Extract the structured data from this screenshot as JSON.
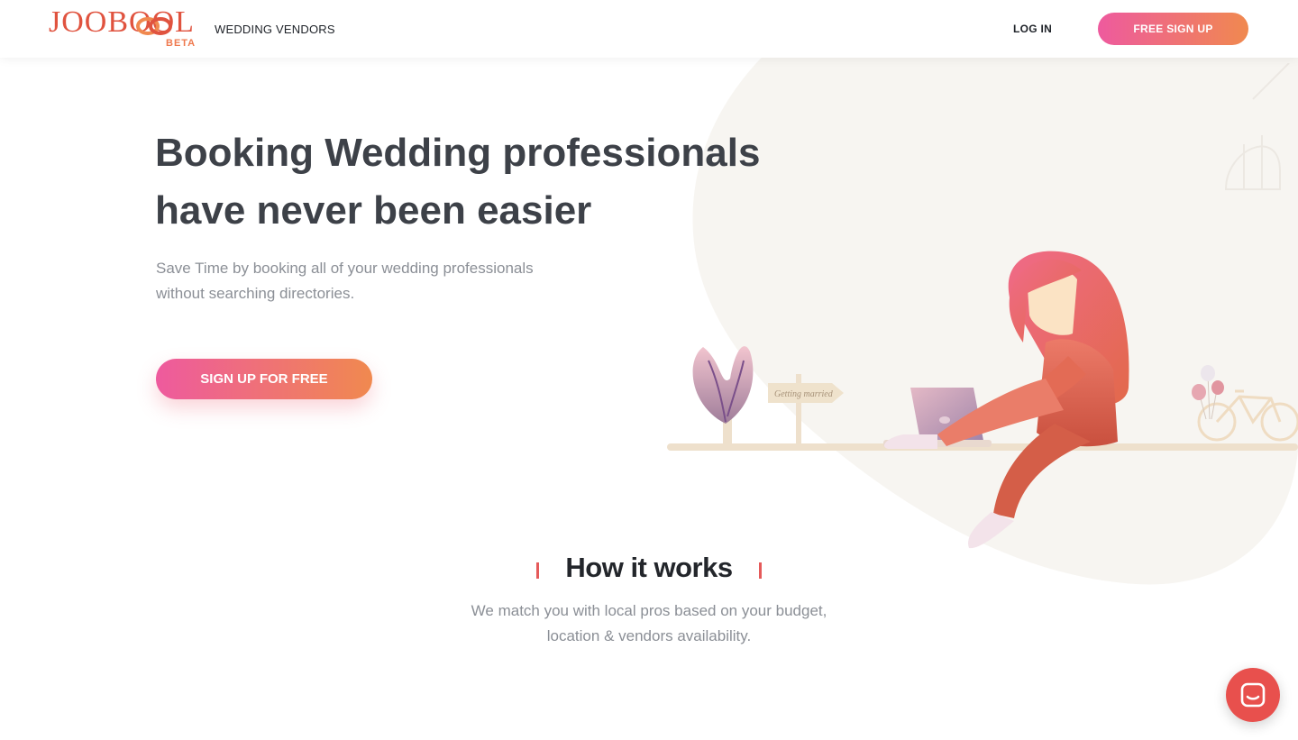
{
  "header": {
    "logo_text": "JOOBOOL",
    "logo_badge": "BETA",
    "nav_vendors": "WEDDING VENDORS",
    "login_label": "LOG IN",
    "signup_label": "FREE SIGN UP"
  },
  "hero": {
    "title_line1": "Booking Wedding professionals",
    "title_line2": "have never been easier",
    "subtitle_line1": "Save Time by booking all of your wedding professionals",
    "subtitle_line2": "without searching directories.",
    "cta_label": "SIGN UP FOR FREE",
    "sign_text": "Getting married"
  },
  "how_it_works": {
    "title": "How it works",
    "subtitle_line1": "We match you with local pros based on your budget,",
    "subtitle_line2": "location & vendors availability."
  },
  "colors": {
    "accent_pink": "#ee5a9e",
    "accent_orange": "#f0894f",
    "chat_red": "#e8504d",
    "heading": "#3d4148",
    "muted": "#8b8f96"
  },
  "icons": {
    "chat": "chat-bubble-icon",
    "rings": "wedding-rings-icon"
  }
}
